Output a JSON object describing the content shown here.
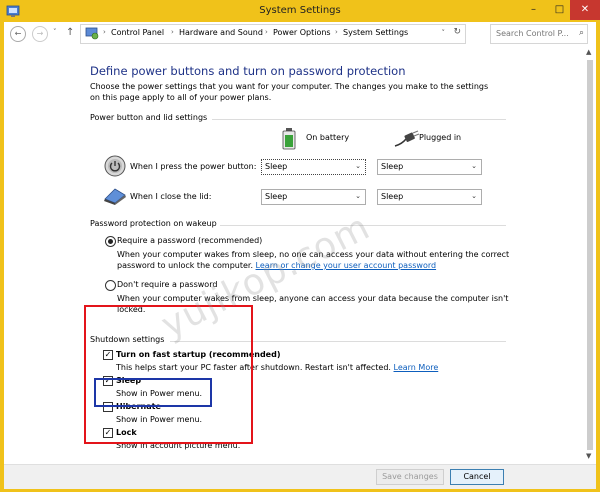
{
  "window": {
    "title": "System Settings"
  },
  "titlebar": {
    "minimize": "–",
    "maximize": "□",
    "close": "✕"
  },
  "nav": {
    "back": "←",
    "forward": "→",
    "recent": "˅",
    "up": "↑",
    "breadcrumbs": [
      "Control Panel",
      "Hardware and Sound",
      "Power Options",
      "System Settings"
    ],
    "crumb_separator": "›",
    "dropdown": "˅",
    "refresh": "↻",
    "search_placeholder": "Search Control P...",
    "search_icon": "⌕"
  },
  "page": {
    "heading": "Define power buttons and turn on password protection",
    "intro": "Choose the power settings that you want for your computer. The changes you make to the settings on this page apply to all of your power plans."
  },
  "power_section": {
    "title": "Power button and lid settings",
    "columns": {
      "battery": "On battery",
      "plugged": "Plugged in"
    },
    "rows": [
      {
        "label": "When I press the power button:",
        "battery": "Sleep",
        "plugged": "Sleep"
      },
      {
        "label": "When I close the lid:",
        "battery": "Sleep",
        "plugged": "Sleep"
      }
    ],
    "arrow": "⌄"
  },
  "password_section": {
    "title": "Password protection on wakeup",
    "require": {
      "label": "Require a password (recommended)",
      "desc_line1": "When your computer wakes from sleep, no one can access your data without entering the correct",
      "desc_line2": "password to unlock the computer.",
      "link": "Learn or change your user account password",
      "selected": true
    },
    "no_require": {
      "label": "Don't require a password",
      "desc_line1": "When your computer wakes from sleep, anyone can access your data because the computer isn't",
      "desc_line2": "locked.",
      "selected": false
    }
  },
  "shutdown_section": {
    "title": "Shutdown settings",
    "items": [
      {
        "label": "Turn on fast startup (recommended)",
        "desc": "This helps start your PC faster after shutdown. Restart isn't affected.",
        "link": "Learn More",
        "checked": true
      },
      {
        "label": "Sleep",
        "desc": "Show in Power menu.",
        "checked": true
      },
      {
        "label": "Hibernate",
        "desc": "Show in Power menu.",
        "checked": false
      },
      {
        "label": "Lock",
        "desc": "Show in account picture menu.",
        "checked": true
      }
    ],
    "check_mark": "✓"
  },
  "watermark": "yujikop.com",
  "footer": {
    "save": "Save changes",
    "cancel": "Cancel"
  },
  "scrollbar": {
    "up": "▲",
    "down": "▼"
  },
  "colors": {
    "window_frame": "#f0c21a",
    "heading": "#1e3287",
    "link": "#0d5ebd",
    "highlight_red": "#e3141a",
    "highlight_blue": "#1d36a7",
    "close_button": "#c7372f"
  }
}
